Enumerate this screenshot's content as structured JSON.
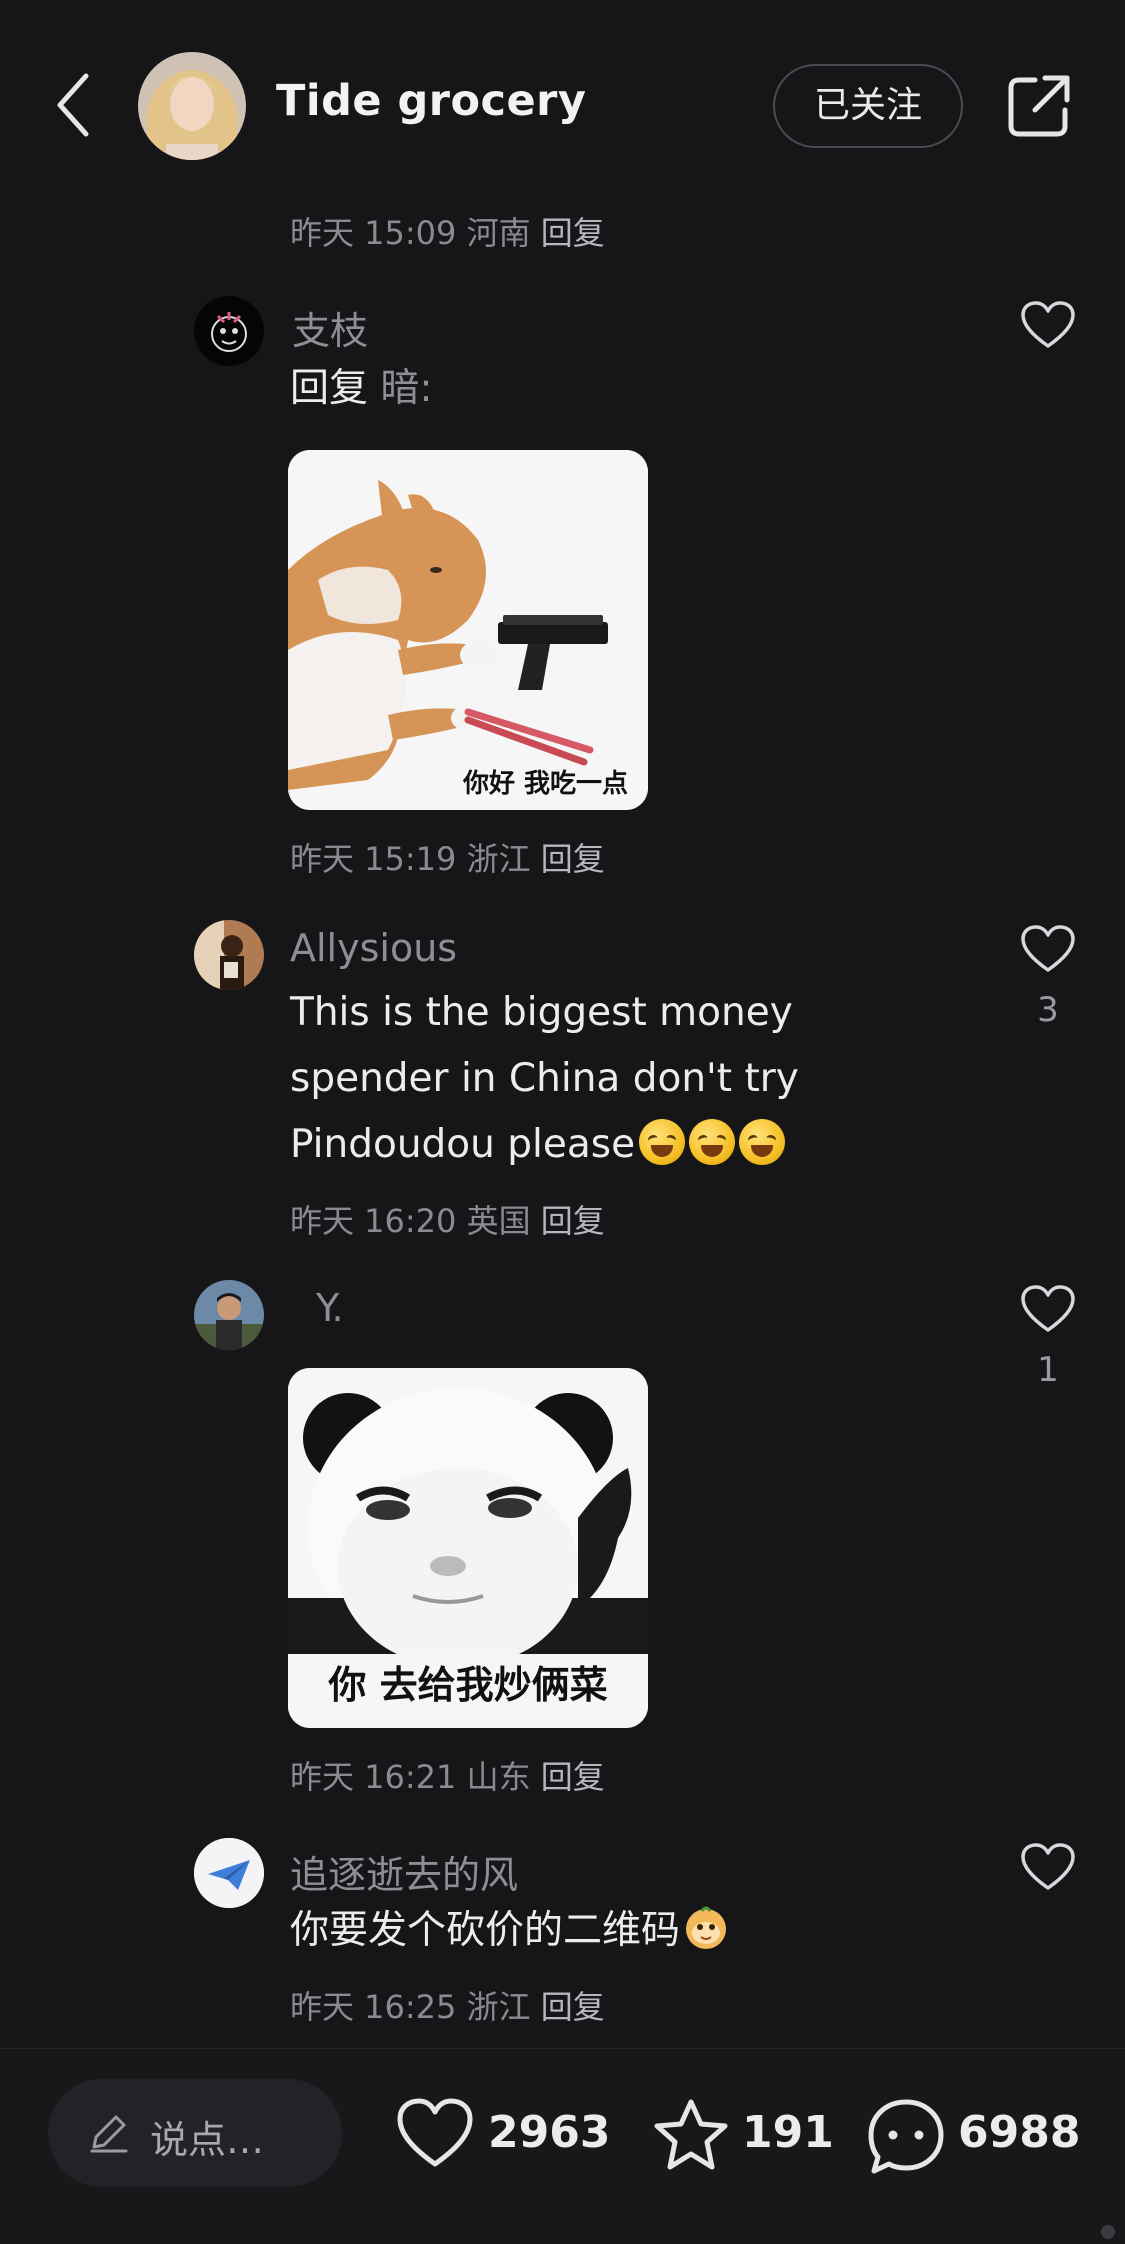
{
  "header": {
    "title": "Tide grocery",
    "follow_label": "已关注"
  },
  "comments": [
    {
      "meta_prefix": "昨天 15:09 河南",
      "reply_label": "回复"
    },
    {
      "name": "支枝",
      "reply_prefix": "回复",
      "reply_target": "暗:",
      "sticker_caption": "你好  我吃一点",
      "meta_prefix": "昨天 15:19 浙江",
      "reply_label": "回复"
    },
    {
      "name": "Allysious",
      "text_lines": [
        "This is the biggest money",
        "spender in China don't try",
        "Pindoudou please"
      ],
      "emoji": [
        "rofl-emoji",
        "rofl-emoji",
        "rofl-emoji"
      ],
      "likes": "3",
      "meta_prefix": "昨天 16:20 英国",
      "reply_label": "回复"
    },
    {
      "name": "Y.",
      "sticker_caption": "你 去给我炒俩菜",
      "likes": "1",
      "meta_prefix": "昨天 16:21 山东",
      "reply_label": "回复"
    },
    {
      "name": "追逐逝去的风",
      "text": "你要发个砍价的二维码",
      "emoji": "monkey-face-emoji",
      "meta_prefix": "昨天 16:25 浙江",
      "reply_label": "回复"
    }
  ],
  "bottom_bar": {
    "input_placeholder": "说点…",
    "likes": "2963",
    "favorites": "191",
    "comments": "6988"
  },
  "colors": {
    "background": "#161619",
    "text_primary": "#ececee",
    "text_muted": "#8e8e94"
  }
}
